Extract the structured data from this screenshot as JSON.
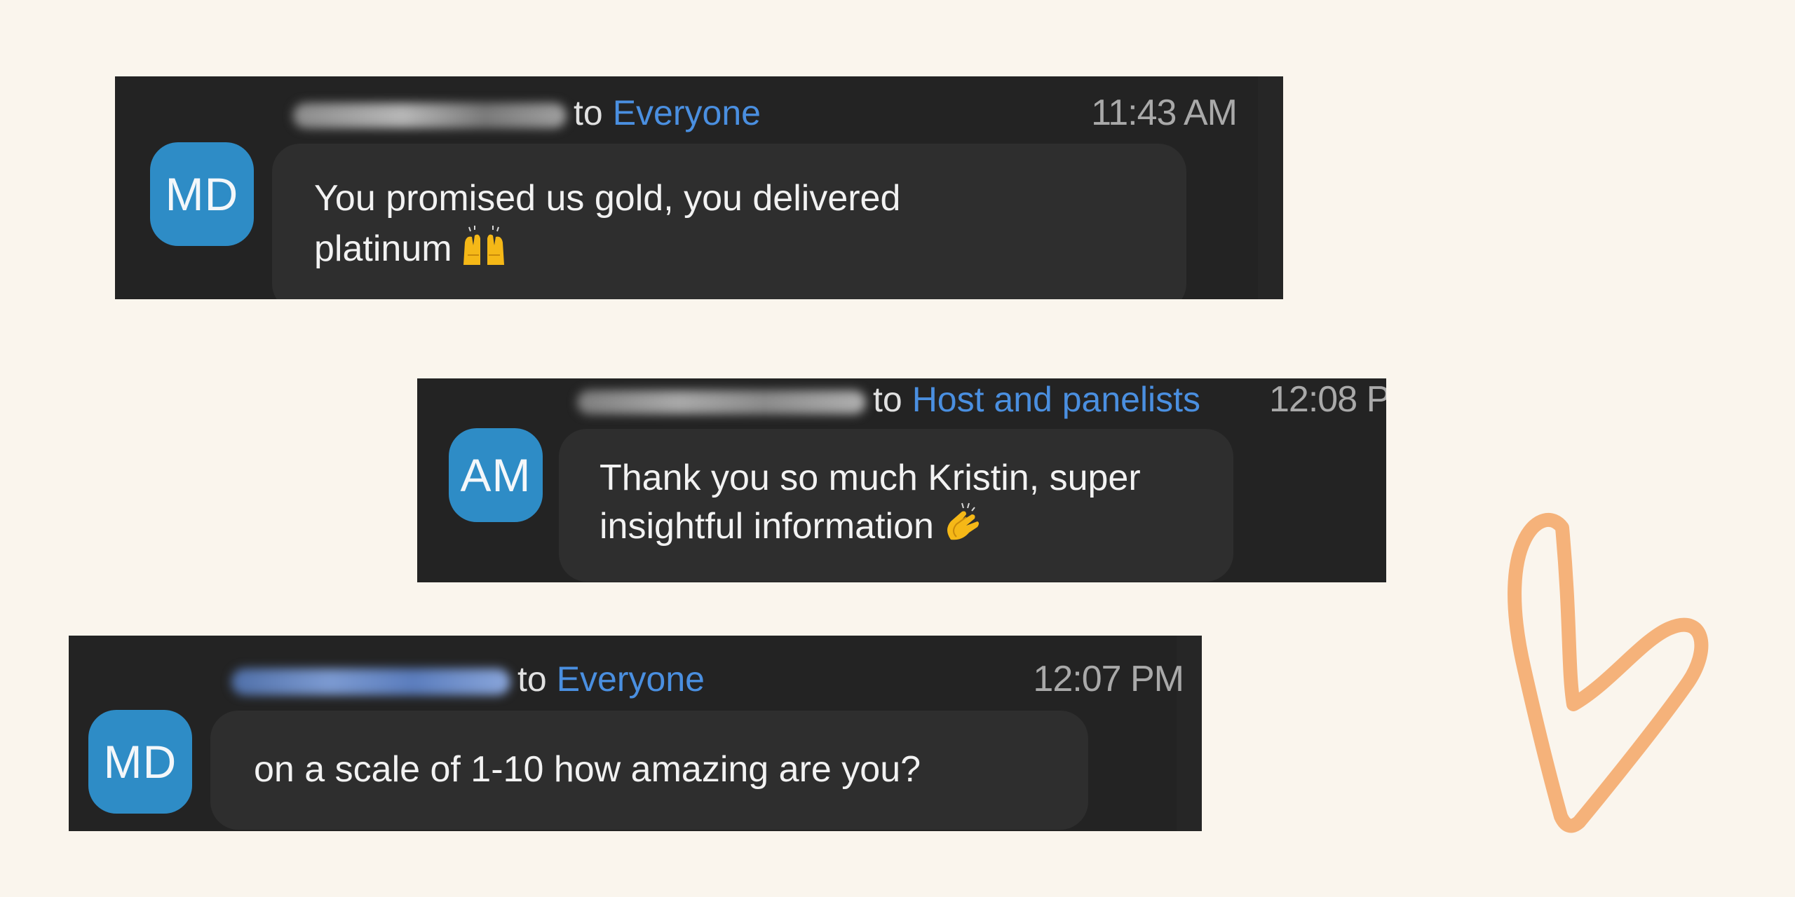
{
  "messages": [
    {
      "initials": "MD",
      "to_word": "to",
      "recipient": "Everyone",
      "time": "11:43 AM",
      "lines": [
        "You promised us gold, you delivered",
        "platinum"
      ],
      "emoji": "raising-hands-emoji"
    },
    {
      "initials": "AM",
      "to_word": "to",
      "recipient": "Host and panelists",
      "time": "12:08 P",
      "lines": [
        "Thank you so much Kristin, super",
        "insightful information"
      ],
      "emoji": "clapping-hands-emoji"
    },
    {
      "initials": "MD",
      "to_word": "to",
      "recipient": "Everyone",
      "time": "12:07 PM",
      "lines": [
        "on a scale of 1-10 how amazing are you?"
      ],
      "emoji": ""
    }
  ],
  "colors": {
    "background": "#faf5ed",
    "card": "#232323",
    "bubble": "#2e2e2e",
    "avatar": "#2e8cc6",
    "recipient_link": "#4a8fe0",
    "timestamp": "#a9a9a9",
    "heart_stroke": "#f5b27a"
  },
  "decoration": {
    "icon": "heart-outline-icon"
  }
}
